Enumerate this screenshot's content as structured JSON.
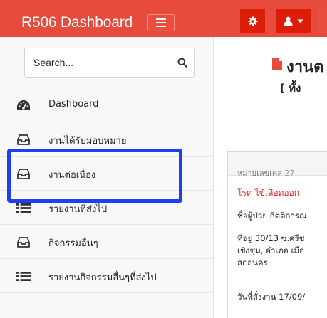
{
  "header": {
    "brand": "R506 Dashboard",
    "accent_color": "#e64b3c",
    "button_color": "#dc1e08",
    "menu_toggle_icon": "bars-icon",
    "settings_icon": "gear-icon",
    "user_icon": "user-icon",
    "user_dropdown_icon": "caret-down-icon"
  },
  "sidebar": {
    "search": {
      "placeholder": "Search...",
      "icon": "search-icon"
    },
    "items": [
      {
        "label": "Dashboard",
        "icon": "dashboard-icon"
      },
      {
        "label": "งานได้รับมอบหมาย",
        "icon": "inbox-icon"
      },
      {
        "label": "งานต่อเนื่อง",
        "icon": "inbox-icon",
        "highlighted": true,
        "highlight_color": "#1f3df5"
      },
      {
        "label": "รายงานที่ส่งไป",
        "icon": "list-icon"
      },
      {
        "label": "กิจกรรมอื่นๆ",
        "icon": "inbox-icon"
      },
      {
        "label": "รายงานกิจกรรมอื่นๆที่ส่งไป",
        "icon": "list-icon"
      }
    ]
  },
  "main": {
    "title": "งานต",
    "title_icon": "file-icon",
    "subtitle": "[ ทั้ง",
    "card": {
      "case_label": "หมายเลขเคส",
      "case_number": "27",
      "disease": "โรค ไข้เลือดออก",
      "patient": "ชื่อผู้ป่วย กิตติการณ",
      "address_lines": [
        "ที่อยู่ 30/13 ซ.ศรีช",
        "เชิงชุม, อำเภอ เมือ",
        "สกลนคร"
      ],
      "order_date": "วันที่สั่งงาน 17/09/"
    }
  }
}
